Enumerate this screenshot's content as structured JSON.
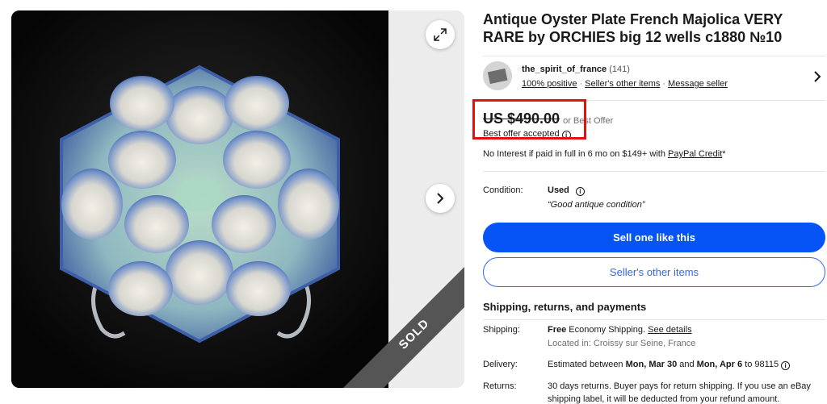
{
  "listing": {
    "title": "Antique Oyster Plate French Majolica VERY RARE by ORCHIES big 12 wells c1880 №10",
    "badge": "SOLD"
  },
  "seller": {
    "name": "the_spirit_of_france",
    "feedback_count": "(141)",
    "positive": "100% positive",
    "other_items": "Seller's other items",
    "message": "Message seller"
  },
  "price": {
    "amount": "US $490.00",
    "offer": "or Best Offer",
    "accepted": "Best offer accepted",
    "financing_prefix": "No Interest if paid in full in 6 mo on $149+ with ",
    "financing_link": "PayPal Credit",
    "financing_suffix": "*"
  },
  "condition": {
    "label": "Condition:",
    "value": "Used",
    "note": "“Good antique condition”"
  },
  "buttons": {
    "sell": "Sell one like this",
    "other_items": "Seller's other items"
  },
  "shipping": {
    "section_title": "Shipping, returns, and payments",
    "shipping_label": "Shipping:",
    "shipping_free": "Free",
    "shipping_rest": " Economy Shipping. ",
    "shipping_link": "See details",
    "location": "Located in: Croissy sur Seine, France",
    "delivery_label": "Delivery:",
    "delivery_prefix": "Estimated between ",
    "delivery_start": "Mon, Mar 30",
    "delivery_and": " and ",
    "delivery_end": "Mon, Apr 6",
    "delivery_suffix": " to 98115",
    "returns_label": "Returns:",
    "returns_line1": "30 days returns. Buyer pays for return shipping. If you use an eBay",
    "returns_line2": "shipping label, it will be deducted from your refund amount."
  },
  "colors": {
    "primary_button": "#0654f5",
    "secondary_border": "#3665f3",
    "highlight": "#e31010"
  }
}
